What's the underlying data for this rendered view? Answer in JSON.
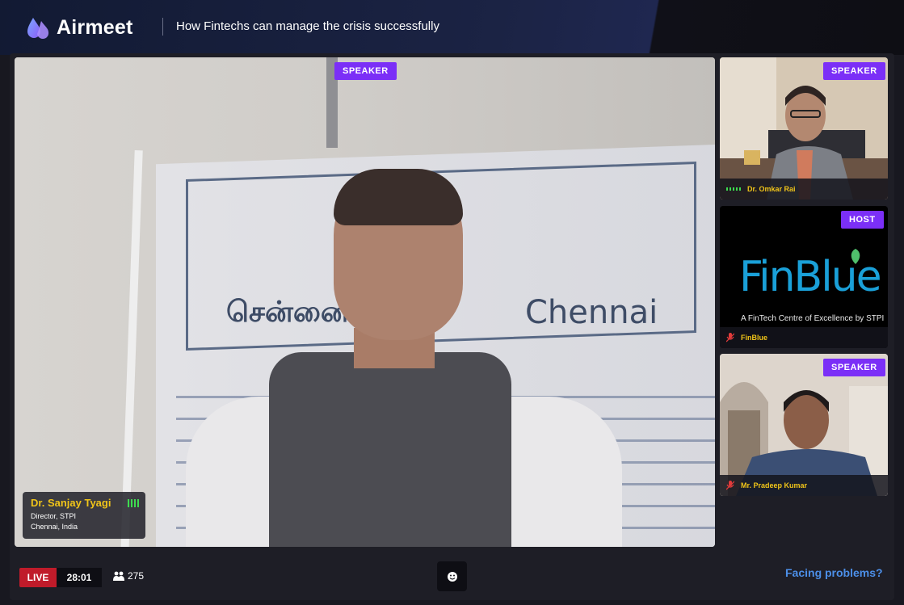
{
  "header": {
    "app_name": "Airmeet",
    "event_title": "How Fintechs can manage the crisis successfully"
  },
  "main_tile": {
    "badge": "SPEAKER",
    "banner_tamil": "சென்னை",
    "banner_city": "Chennai",
    "speaker": {
      "name": "Dr. Sanjay Tyagi",
      "title": "Director, STPI",
      "location": "Chennai, India"
    }
  },
  "side_tiles": [
    {
      "badge": "SPEAKER",
      "name": "Dr. Omkar Rai",
      "audio": "speaking"
    },
    {
      "badge": "HOST",
      "name": "FinBlue",
      "audio": "muted",
      "logo_text": "FinBlue",
      "tagline": "A FinTech Centre of Excellence by STPI"
    },
    {
      "badge": "SPEAKER",
      "name": "Mr. Pradeep Kumar",
      "audio": "muted"
    }
  ],
  "bottom_bar": {
    "live_label": "LIVE",
    "timer": "28:01",
    "attendee_count": "275",
    "help_link": "Facing problems?"
  },
  "colors": {
    "badge": "#7b2ff7",
    "live": "#c01b2a",
    "speaker_name": "#f0c419",
    "help_link": "#4c8fe8"
  }
}
